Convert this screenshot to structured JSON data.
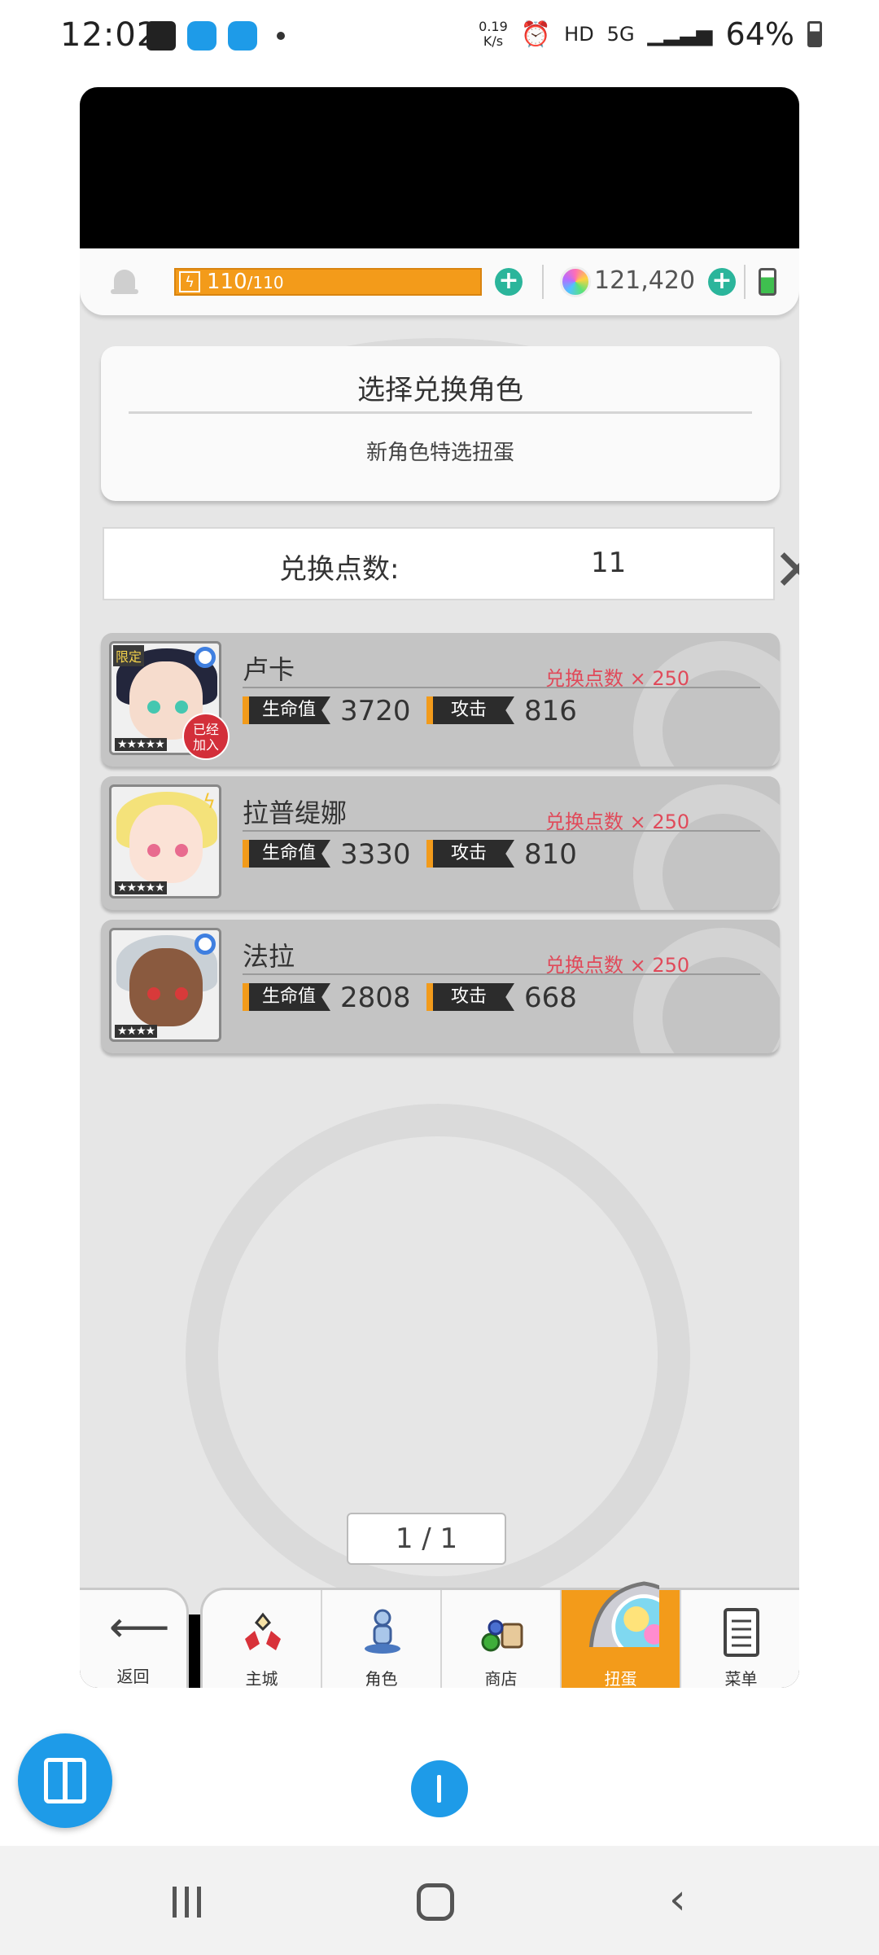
{
  "status_bar": {
    "time": "12:02",
    "net_speed": "0.19\nK/s",
    "network": "5G",
    "hd": "HD",
    "battery": "64%"
  },
  "resources": {
    "energy": "110",
    "energy_max": "/110",
    "gems": "121,420"
  },
  "header": {
    "title": "选择兑换角色",
    "subtitle": "新角色特选扭蛋"
  },
  "points": {
    "label": "兑换点数:",
    "value": "11"
  },
  "characters": [
    {
      "name": "卢卡",
      "cost": "兑换点数 × 250",
      "hp_label": "生命值",
      "hp": "3720",
      "atk_label": "攻击",
      "atk": "816",
      "stars": "★★★★★",
      "limited": "限定",
      "joined": "已经\n加入"
    },
    {
      "name": "拉普缇娜",
      "cost": "兑换点数 × 250",
      "hp_label": "生命值",
      "hp": "3330",
      "atk_label": "攻击",
      "atk": "810",
      "stars": "★★★★★"
    },
    {
      "name": "法拉",
      "cost": "兑换点数 × 250",
      "hp_label": "生命值",
      "hp": "2808",
      "atk_label": "攻击",
      "atk": "668",
      "stars": "★★★★"
    }
  ],
  "pagination": "1 / 1",
  "nav": {
    "back": "返回",
    "items": [
      "主城",
      "角色",
      "商店",
      "扭蛋",
      "菜单"
    ],
    "active": "扭蛋"
  },
  "colors": {
    "accent_orange": "#f39b1a",
    "cost_red": "#e04a5a",
    "plus_teal": "#2bb59b",
    "app_blue": "#1e9be8"
  }
}
